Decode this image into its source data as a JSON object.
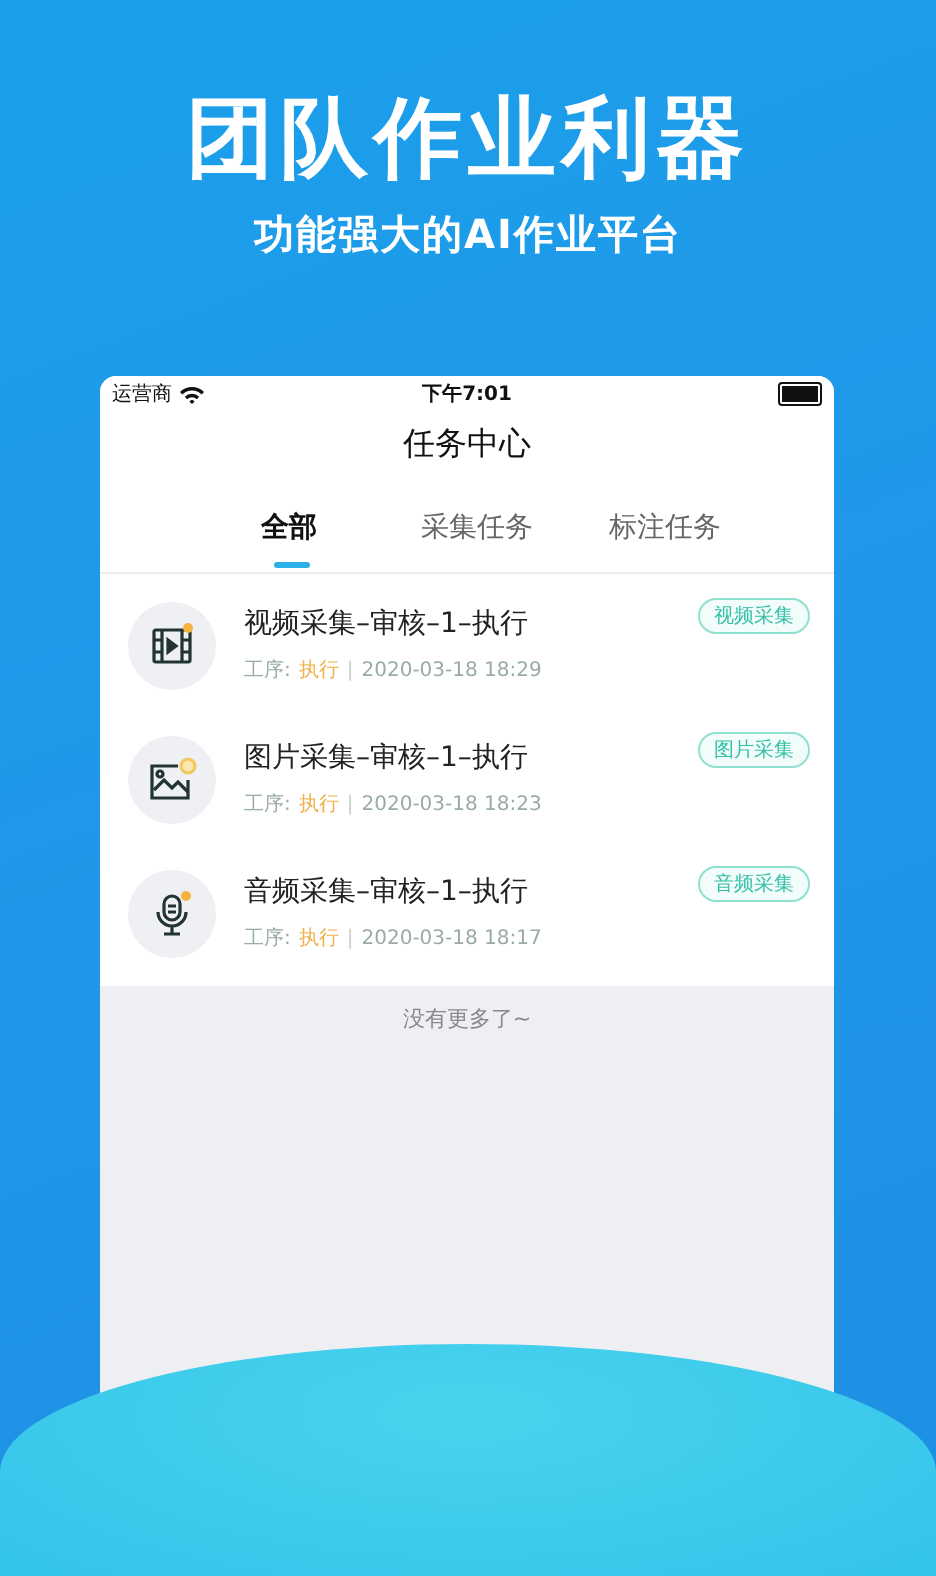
{
  "headline": "团队作业利器",
  "subtitle": "功能强大的AI作业平台",
  "status_bar": {
    "carrier": "运营商",
    "time": "下午7:01"
  },
  "title": "任务中心",
  "tabs": [
    {
      "label": "全部",
      "selected": true
    },
    {
      "label": "采集任务",
      "selected": false
    },
    {
      "label": "标注任务",
      "selected": false
    }
  ],
  "tasks": [
    {
      "kind": "video",
      "title": "视频采集–审核–1–执行",
      "step_label": "工序:",
      "step": "执行",
      "separator": "|",
      "time": "2020-03-18 18:29",
      "tag": "视频采集"
    },
    {
      "kind": "image",
      "title": "图片采集–审核–1–执行",
      "step_label": "工序:",
      "step": "执行",
      "separator": "|",
      "time": "2020-03-18 18:23",
      "tag": "图片采集"
    },
    {
      "kind": "audio",
      "title": "音频采集–审核–1–执行",
      "step_label": "工序:",
      "step": "执行",
      "separator": "|",
      "time": "2020-03-18 18:17",
      "tag": "音频采集"
    }
  ],
  "footer_note": "没有更多了~"
}
